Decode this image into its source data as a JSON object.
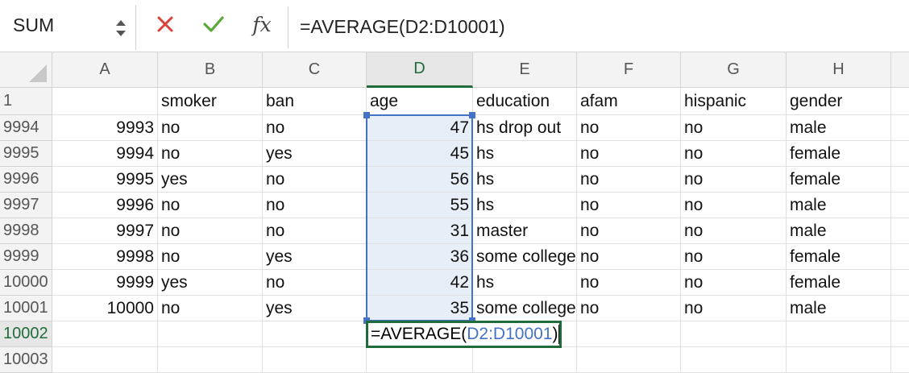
{
  "name_box": {
    "value": "SUM"
  },
  "formula_bar": {
    "cancel_icon": "x-icon",
    "enter_icon": "check-icon",
    "fx_label": "fx",
    "formula": "=AVERAGE(D2:D10001)"
  },
  "columns": [
    "A",
    "B",
    "C",
    "D",
    "E",
    "F",
    "G",
    "H"
  ],
  "rows": [
    {
      "num": "1",
      "cells": [
        "",
        "smoker",
        "ban",
        "age",
        "education",
        "afam",
        "hispanic",
        "gender"
      ]
    },
    {
      "num": "9994",
      "cells": [
        "9993",
        "no",
        "no",
        "47",
        "hs drop out",
        "no",
        "no",
        "male"
      ]
    },
    {
      "num": "9995",
      "cells": [
        "9994",
        "no",
        "yes",
        "45",
        "hs",
        "no",
        "no",
        "female"
      ]
    },
    {
      "num": "9996",
      "cells": [
        "9995",
        "yes",
        "no",
        "56",
        "hs",
        "no",
        "no",
        "female"
      ]
    },
    {
      "num": "9997",
      "cells": [
        "9996",
        "no",
        "no",
        "55",
        "hs",
        "no",
        "no",
        "male"
      ]
    },
    {
      "num": "9998",
      "cells": [
        "9997",
        "no",
        "no",
        "31",
        "master",
        "no",
        "no",
        "male"
      ]
    },
    {
      "num": "9999",
      "cells": [
        "9998",
        "no",
        "yes",
        "36",
        "some college",
        "no",
        "no",
        "female"
      ]
    },
    {
      "num": "10000",
      "cells": [
        "9999",
        "yes",
        "no",
        "42",
        "hs",
        "no",
        "no",
        "female"
      ]
    },
    {
      "num": "10001",
      "cells": [
        "10000",
        "no",
        "yes",
        "35",
        "some college",
        "no",
        "no",
        "male"
      ]
    },
    {
      "num": "10002",
      "cells": [
        "",
        "",
        "",
        "",
        "",
        "",
        "",
        ""
      ]
    },
    {
      "num": "10003",
      "cells": [
        "",
        "",
        "",
        "",
        "",
        "",
        "",
        ""
      ]
    }
  ],
  "active_cell": {
    "row": "10002",
    "column": "D",
    "prefix": "=AVERAGE(",
    "reference": "D2:D10001",
    "suffix": ")"
  },
  "colors": {
    "accent_green": "#1f6b3a",
    "range_blue": "#4472c4",
    "cancel_red": "#d9403a",
    "enter_green": "#5aa83a"
  }
}
